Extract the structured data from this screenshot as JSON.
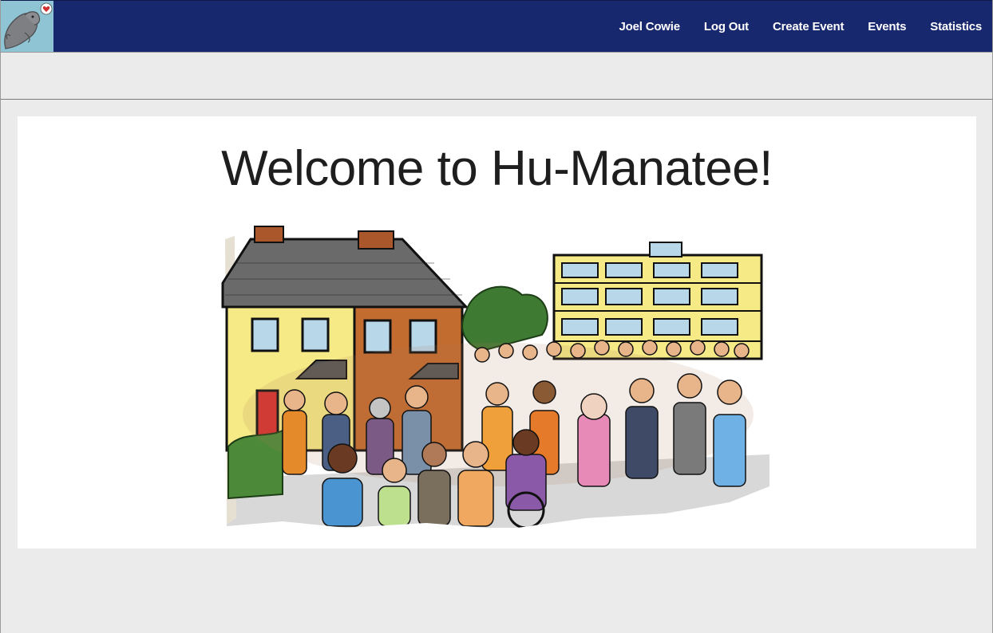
{
  "navbar": {
    "logo_icon": "manatee-heart-icon",
    "links": [
      {
        "label": "Joel Cowie"
      },
      {
        "label": "Log Out"
      },
      {
        "label": "Create Event"
      },
      {
        "label": "Events"
      },
      {
        "label": "Statistics"
      }
    ]
  },
  "main": {
    "title": "Welcome to Hu-Manatee!",
    "illustration": "community-crowd-illustration"
  },
  "colors": {
    "navbar": "#18286e",
    "background": "#ebebeb",
    "card": "#ffffff"
  }
}
